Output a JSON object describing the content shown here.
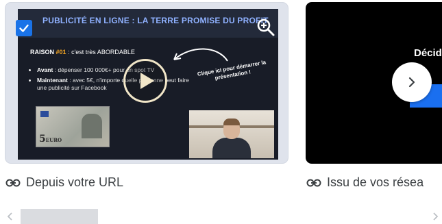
{
  "cards": [
    {
      "caption": "Depuis votre URL",
      "slide": {
        "title": "PUBLICITÉ EN LIGNE : LA TERRE PROMISE DU PROFIT",
        "raison_prefix": "RAISON",
        "raison_num": "#01",
        "raison_text": ": c'est très ABORDABLE",
        "bullets": [
          {
            "label": "Avant",
            "text": ": dépenser 100 000€+ pour un spot TV"
          },
          {
            "label": "Maintenant",
            "text": ": avec 5€, n'importe quelle personne peut faire une publicité sur Facebook"
          }
        ],
        "cta": "Clique ici pour démarrer la présentation !",
        "banknote_value": "5",
        "banknote_text": "EURO"
      }
    },
    {
      "caption": "Issu de vos résea",
      "thumb_text": "Décid"
    }
  ],
  "icons": {
    "checkbox": "check-icon",
    "zoom": "zoom-in-icon",
    "play": "play-icon",
    "next": "chevron-right-icon",
    "link": "link-icon",
    "scroll_left": "chevron-left-icon",
    "scroll_right": "chevron-right-icon"
  },
  "colors": {
    "accent": "#1a73e8",
    "caption_text": "#3c4043",
    "scroll_thumb": "#dadce0"
  }
}
